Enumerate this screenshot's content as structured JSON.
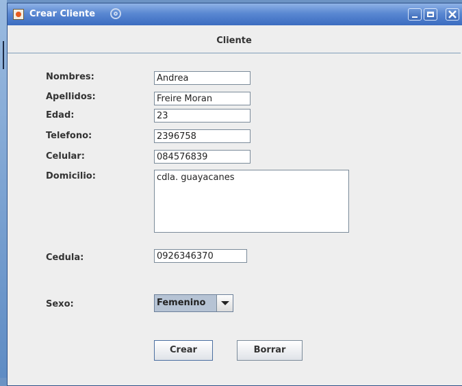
{
  "window": {
    "title": "Crear Cliente"
  },
  "form": {
    "header": "Cliente",
    "fields": {
      "nombres": {
        "label": "Nombres:",
        "value": "Andrea"
      },
      "apellidos": {
        "label": "Apellidos:",
        "value": "Freire Moran"
      },
      "edad": {
        "label": "Edad:",
        "value": "23"
      },
      "telefono": {
        "label": "Telefono:",
        "value": "2396758"
      },
      "celular": {
        "label": "Celular:",
        "value": "084576839"
      },
      "domicilio": {
        "label": "Domicilio:",
        "value": "cdla. guayacanes"
      },
      "cedula": {
        "label": "Cedula:",
        "value": "0926346370"
      },
      "sexo": {
        "label": "Sexo:",
        "value": "Femenino"
      }
    },
    "buttons": {
      "crear": "Crear",
      "borrar": "Borrar"
    }
  },
  "icons": {
    "app": "java-app-icon",
    "title_decoration": "spiral-icon",
    "minimize": "minimize-icon",
    "maximize": "maximize-icon",
    "close": "close-icon",
    "dropdown": "chevron-down-icon"
  }
}
